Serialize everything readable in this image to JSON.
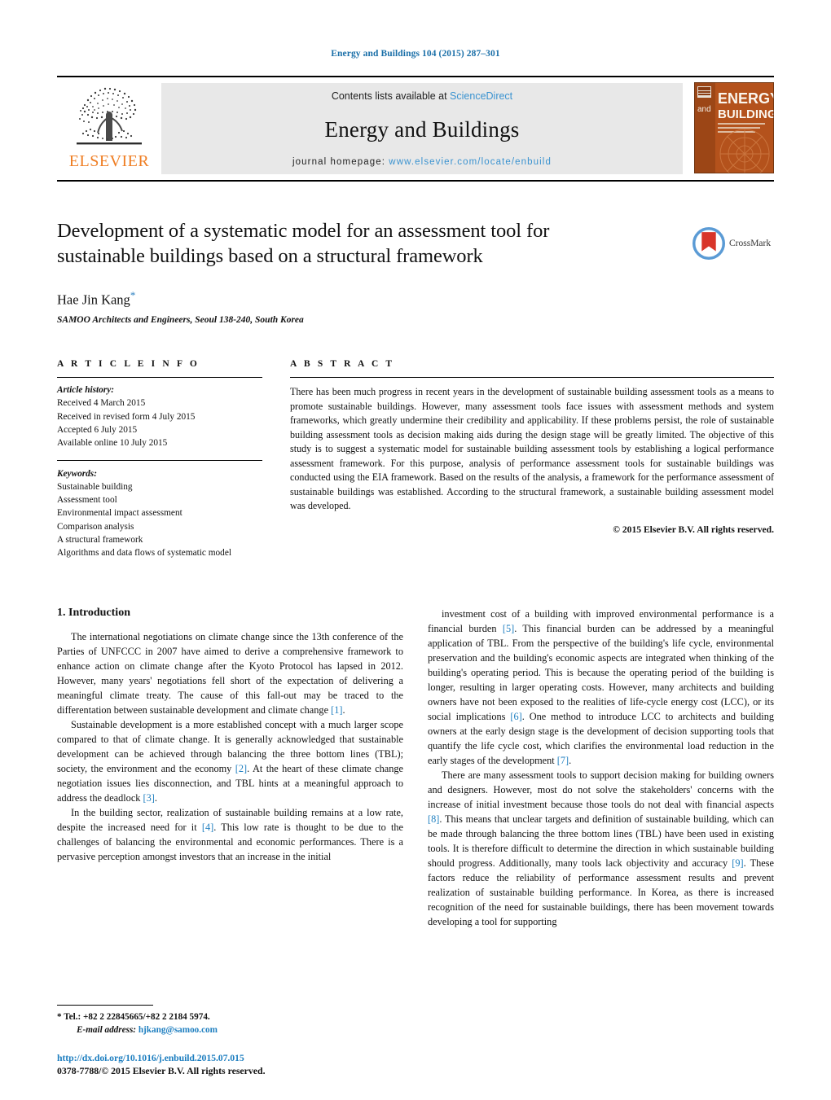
{
  "running_head": "Energy and Buildings 104 (2015) 287–301",
  "masthead": {
    "publisher_name": "ELSEVIER",
    "contents_prefix": "Contents lists available at ",
    "contents_link": "ScienceDirect",
    "journal_name": "Energy and Buildings",
    "homepage_prefix": "journal homepage: ",
    "homepage_url": "www.elsevier.com/locate/enbuild",
    "cover_title_top": "ENERGY",
    "cover_title_bottom": "BUILDINGS",
    "cover_and": "and"
  },
  "article": {
    "title": "Development of a systematic model for an assessment tool for sustainable buildings based on a structural framework",
    "crossmark_label": "CrossMark",
    "author": "Hae Jin Kang",
    "author_marker": "*",
    "affiliation": "SAMOO Architects and Engineers, Seoul 138-240, South Korea"
  },
  "article_info": {
    "heading": "A R T I C L E   I N F O",
    "history_label": "Article history:",
    "history": [
      "Received 4 March 2015",
      "Received in revised form 4 July 2015",
      "Accepted 6 July 2015",
      "Available online 10 July 2015"
    ],
    "keywords_label": "Keywords:",
    "keywords": [
      "Sustainable building",
      "Assessment tool",
      "Environmental impact assessment",
      "Comparison analysis",
      "A structural framework",
      "Algorithms and data flows of systematic model"
    ]
  },
  "abstract": {
    "heading": "A B S T R A C T",
    "text": "There has been much progress in recent years in the development of sustainable building assessment tools as a means to promote sustainable buildings. However, many assessment tools face issues with assessment methods and system frameworks, which greatly undermine their credibility and applicability. If these problems persist, the role of sustainable building assessment tools as decision making aids during the design stage will be greatly limited. The objective of this study is to suggest a systematic model for sustainable building assessment tools by establishing a logical performance assessment framework. For this purpose, analysis of performance assessment tools for sustainable buildings was conducted using the EIA framework. Based on the results of the analysis, a framework for the performance assessment of sustainable buildings was established. According to the structural framework, a sustainable building assessment model was developed.",
    "copyright": "© 2015 Elsevier B.V. All rights reserved."
  },
  "body": {
    "section_title": "1.  Introduction",
    "left_paragraphs": [
      "The international negotiations on climate change since the 13th conference of the Parties of UNFCCC in 2007 have aimed to derive a comprehensive framework to enhance action on climate change after the Kyoto Protocol has lapsed in 2012. However, many years' negotiations fell short of the expectation of delivering a meaningful climate treaty. The cause of this fall-out may be traced to the differentation between sustainable development and climate change [1].",
      "Sustainable development is a more established concept with a much larger scope compared to that of climate change. It is generally acknowledged that sustainable development can be achieved through balancing the three bottom lines (TBL); society, the environment and the economy [2]. At the heart of these climate change negotiation issues lies disconnection, and TBL hints at a meaningful approach to address the deadlock [3].",
      "In the building sector, realization of sustainable building remains at a low rate, despite the increased need for it [4]. This low rate is thought to be due to the challenges of balancing the environmental and economic performances. There is a pervasive perception amongst investors that an increase in the initial"
    ],
    "right_paragraphs": [
      "investment cost of a building with improved environmental performance is a financial burden [5]. This financial burden can be addressed by a meaningful application of TBL. From the perspective of the building's life cycle, environmental preservation and the building's economic aspects are integrated when thinking of the building's operating period. This is because the operating period of the building is longer, resulting in larger operating costs. However, many architects and building owners have not been exposed to the realities of life-cycle energy cost (LCC), or its social implications [6]. One method to introduce LCC to architects and building owners at the early design stage is the development of decision supporting tools that quantify the life cycle cost, which clarifies the environmental load reduction in the early stages of the development [7].",
      "There are many assessment tools to support decision making for building owners and designers. However, most do not solve the stakeholders' concerns with the increase of initial investment because those tools do not deal with financial aspects [8]. This means that unclear targets and definition of sustainable building, which can be made through balancing the three bottom lines (TBL) have been used in existing tools. It is therefore difficult to determine the direction in which sustainable building should progress. Additionally, many tools lack objectivity and accuracy [9]. These factors reduce the reliability of performance assessment results and prevent realization of sustainable building performance. In Korea, as there is increased recognition of the need for sustainable buildings, there has been movement towards developing a tool for supporting"
    ]
  },
  "footer": {
    "tel_marker": "*",
    "tel_label": "Tel.: ",
    "tel_value": "+82 2 22845665/+82 2 2184 5974.",
    "email_label": "E-mail address: ",
    "email_value": "hjkang@samoo.com",
    "doi_url": "http://dx.doi.org/10.1016/j.enbuild.2015.07.015",
    "issn_line": "0378-7788/© 2015 Elsevier B.V. All rights reserved."
  },
  "colors": {
    "link_blue": "#1f7fc0",
    "elsevier_orange": "#ef7d22",
    "band_gray": "#e8e8e8",
    "cover_orange": "#c0561f"
  }
}
